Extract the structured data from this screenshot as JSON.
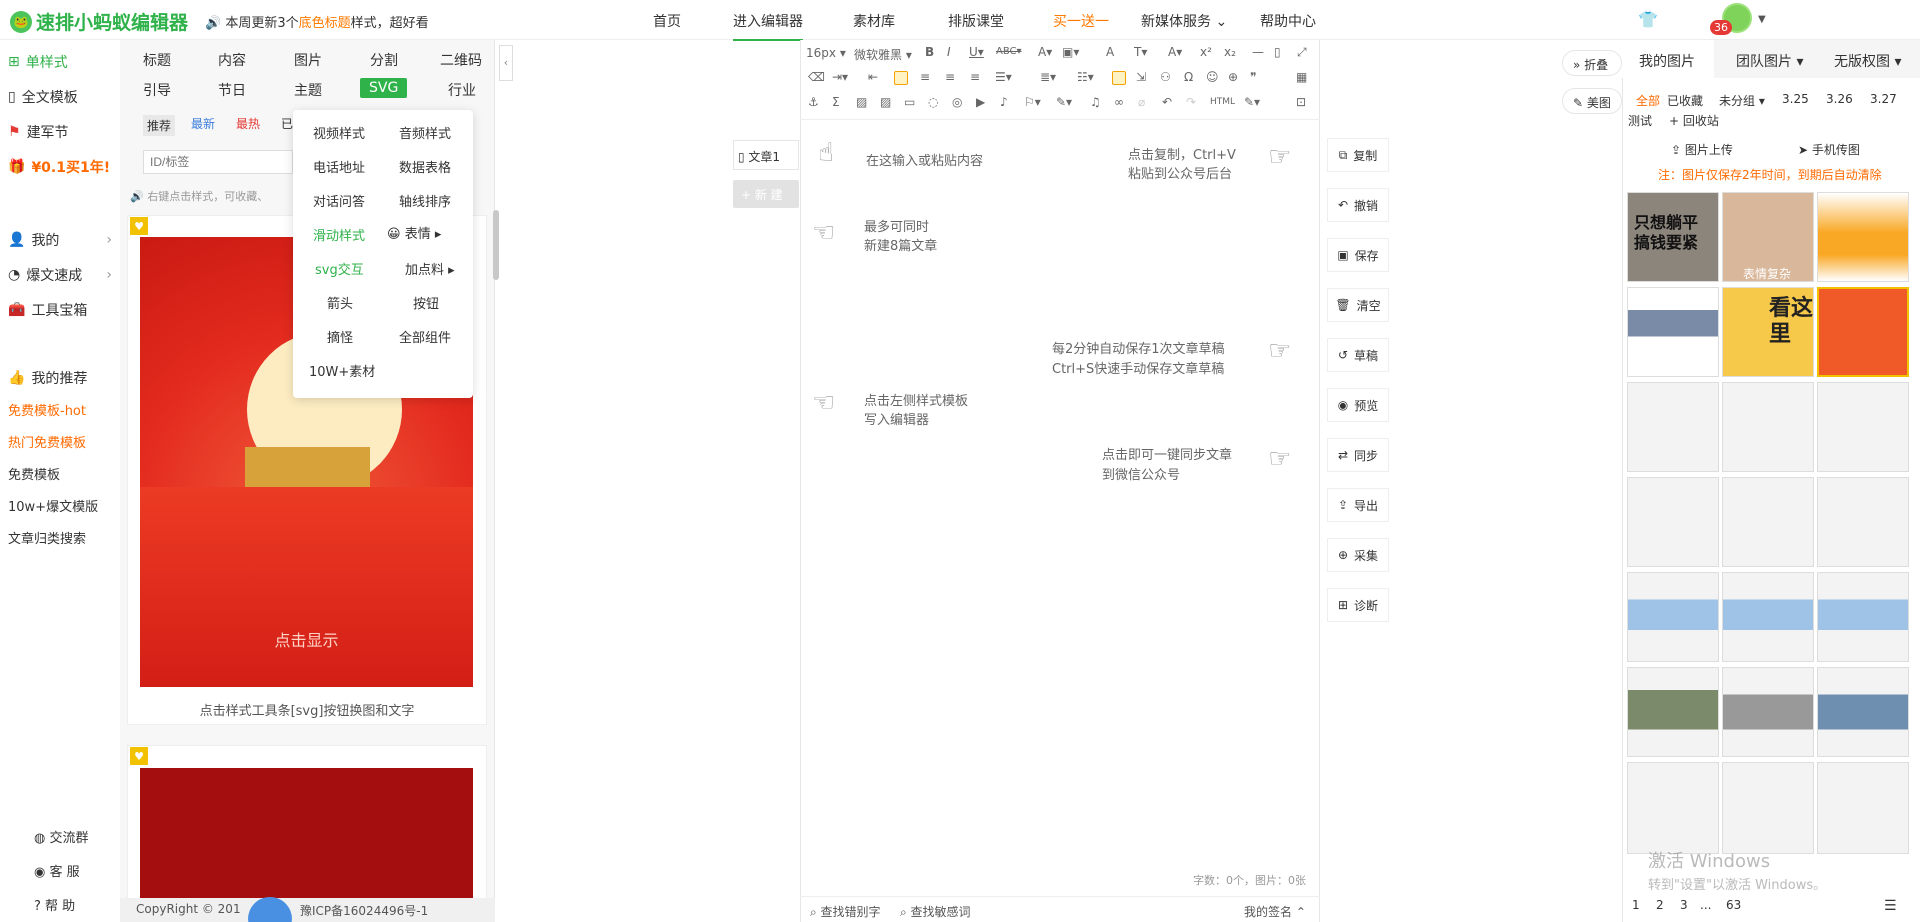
{
  "logo": {
    "text": "速排小蚂蚁编辑器"
  },
  "notice": {
    "pre": "本周更新3个",
    "highlight": "底色标题",
    "post": "样式，超好看"
  },
  "nav": [
    {
      "label": "首页"
    },
    {
      "label": "进入编辑器"
    },
    {
      "label": "素材库"
    },
    {
      "label": "排版课堂"
    },
    {
      "label": "买一送一"
    },
    {
      "label": "新媒体服务 ⌄"
    },
    {
      "label": "帮助中心"
    }
  ],
  "user": {
    "badge": "36"
  },
  "left_rail": {
    "items": [
      "单样式",
      "全文模板",
      "建军节",
      "¥0.1买1年!",
      "我的",
      "爆文速成",
      "工具宝箱",
      "我的推荐"
    ],
    "subs": [
      "免费模板-hot",
      "热门免费模板",
      "免费模板",
      "10w+爆文模版",
      "文章归类搜索"
    ],
    "bottom": [
      "交流群",
      "客 服",
      "帮 助"
    ]
  },
  "categories": [
    "标题",
    "内容",
    "图片",
    "分割",
    "二维码",
    "引导",
    "节日",
    "主题",
    "SVG",
    "行业"
  ],
  "filters": [
    "推荐",
    "最新",
    "最热",
    "已"
  ],
  "search": {
    "placeholder": "ID/标签"
  },
  "tip": "右键点击样式，可收藏、",
  "dropdown": [
    "视频样式",
    "音频样式",
    "电话地址",
    "数据表格",
    "对话问答",
    "轴线排序",
    "滑动样式",
    "表情",
    "svg交互",
    "加点料",
    "箭头",
    "按钮",
    "摘怪",
    "全部组件",
    "10W+素材"
  ],
  "card1": {
    "overlay": "点击显示",
    "caption": "点击样式工具条[svg]按钮换图和文字"
  },
  "copyright": "CopyRight © 201",
  "icp": "豫ICP备16024496号-1",
  "articles": {
    "item": "文章1",
    "new": "+ 新 建"
  },
  "toolbar": {
    "font_size": "16px",
    "font_family": "微软雅黑"
  },
  "hints": [
    "在这输入或粘贴内容",
    "点击复制，Ctrl+V",
    "粘贴到公众号后台",
    "最多可同时",
    "新建8篇文章",
    "每2分钟自动保存1次文章草稿",
    "Ctrl+S快速手动保存文章草稿",
    "点击左侧样式模板",
    "写入编辑器",
    "点击即可一键同步文章",
    "到微信公众号"
  ],
  "wordcount": "字数：0个，图片：0张",
  "bottom": {
    "find_typo": "查找错别字",
    "find_sensitive": "查找敏感词",
    "signature": "我的签名 ⌃"
  },
  "actions": [
    "复制",
    "撤销",
    "保存",
    "清空",
    "草稿",
    "预览",
    "同步",
    "导出",
    "采集",
    "诊断"
  ],
  "right_buttons": [
    "» 折叠",
    "美图"
  ],
  "image_panel": {
    "tabs": [
      "我的图片",
      "团队图片 ▾",
      "无版权图 ▾"
    ],
    "folders": [
      "全部",
      "已收藏",
      "未分组 ▾",
      "3.25",
      "3.26",
      "3.27",
      "测试",
      "+ 回收站"
    ],
    "upload": "图片上传",
    "phone": "手机传图",
    "note": "注：图片仅保存2年时间，到期后自动清除",
    "thumb_labels": [
      "只想躺平 搞钱要紧",
      "表情复杂",
      "看这里"
    ],
    "pager": [
      "1",
      "2",
      "3",
      "...",
      "63"
    ]
  },
  "watermark": [
    "激活 Windows",
    "转到\"设置\"以激活 Windows。"
  ]
}
